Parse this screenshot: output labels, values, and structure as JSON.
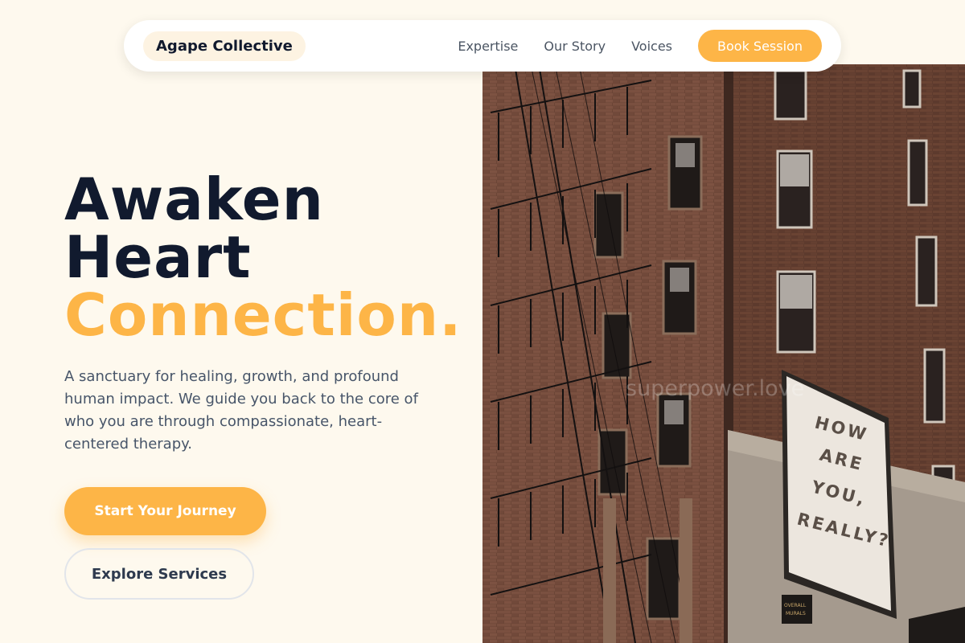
{
  "nav": {
    "brand": "Agape Collective",
    "links": [
      "Expertise",
      "Our Story",
      "Voices"
    ],
    "cta": "Book Session"
  },
  "hero": {
    "headline": [
      "Awaken",
      "Heart",
      "Connection."
    ],
    "description": "A sanctuary for healing, growth, and profound human impact. We guide you back to the core of who you are through compassionate, heart-centered therapy.",
    "primary_cta": "Start Your Journey",
    "secondary_cta": "Explore Services",
    "image": {
      "mural_lines": [
        "HOW",
        "ARE",
        "YOU,",
        "REALLY?"
      ],
      "sign_lines": [
        "OVERALL",
        "MURALS"
      ],
      "watermark": "superpower.love"
    }
  },
  "colors": {
    "background": "#fef9ee",
    "accent": "#fdb547",
    "heading": "#111a2e",
    "body_text": "#475569"
  }
}
